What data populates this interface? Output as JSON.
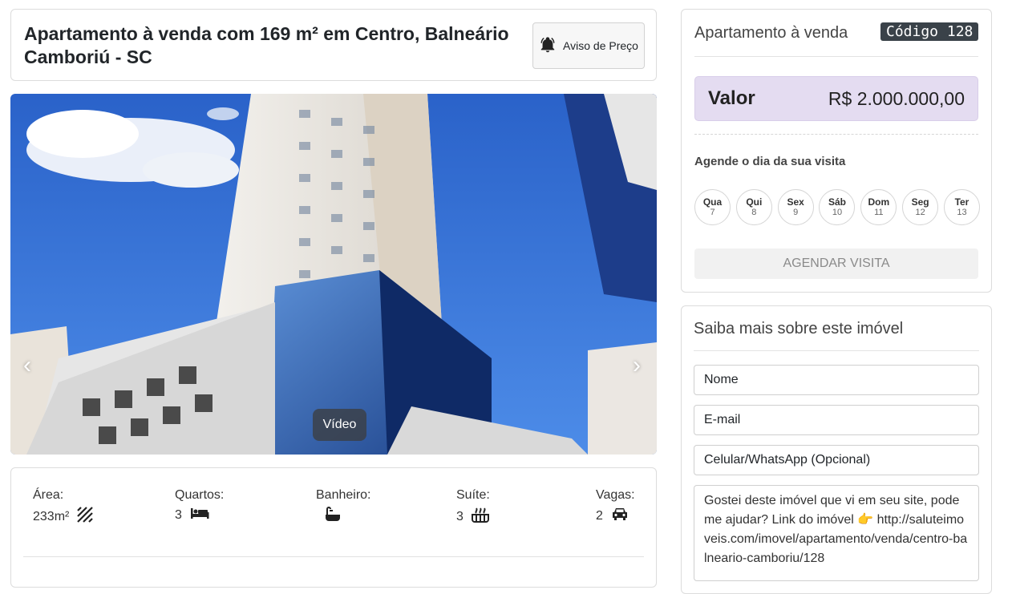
{
  "listing": {
    "title": "Apartamento à venda com 169 m² em Centro, Balneário Camboriú - SC",
    "price_alert_label": "Aviso de Preço"
  },
  "gallery": {
    "prev_icon": "chevron-left-icon",
    "next_icon": "chevron-right-icon",
    "video_label": "Vídeo"
  },
  "features": [
    {
      "label": "Área:",
      "value": "233m²",
      "icon": "area-hatch-icon"
    },
    {
      "label": "Quartos:",
      "value": "3",
      "icon": "bed-icon"
    },
    {
      "label": "Banheiro:",
      "value": "",
      "icon": "bathtub-icon"
    },
    {
      "label": "Suíte:",
      "value": "3",
      "icon": "suite-bath-icon"
    },
    {
      "label": "Vagas:",
      "value": "2",
      "icon": "car-icon"
    }
  ],
  "sale": {
    "title": "Apartamento à venda",
    "code": "Código 128",
    "price_label": "Valor",
    "price_value": "R$ 2.000.000,00",
    "visit_title": "Agende o dia da sua visita",
    "days": [
      {
        "name": "Qua",
        "date": "7"
      },
      {
        "name": "Qui",
        "date": "8"
      },
      {
        "name": "Sex",
        "date": "9"
      },
      {
        "name": "Sáb",
        "date": "10"
      },
      {
        "name": "Dom",
        "date": "11"
      },
      {
        "name": "Seg",
        "date": "12"
      },
      {
        "name": "Ter",
        "date": "13"
      }
    ],
    "schedule_button": "AGENDAR VISITA"
  },
  "contact": {
    "title": "Saiba mais sobre este imóvel",
    "name_placeholder": "Nome",
    "email_placeholder": "E-mail",
    "phone_placeholder": "Celular/WhatsApp (Opcional)",
    "message": "Gostei deste imóvel que vi em seu site, pode me ajudar? Link do imóvel 👉 http://saluteimoveis.com/imovel/apartamento/venda/centro-balneario-camboriu/128"
  },
  "colors": {
    "price_box": "#e4dcf1",
    "code_badge": "#3a4249",
    "sky": "#2f6fd6"
  }
}
